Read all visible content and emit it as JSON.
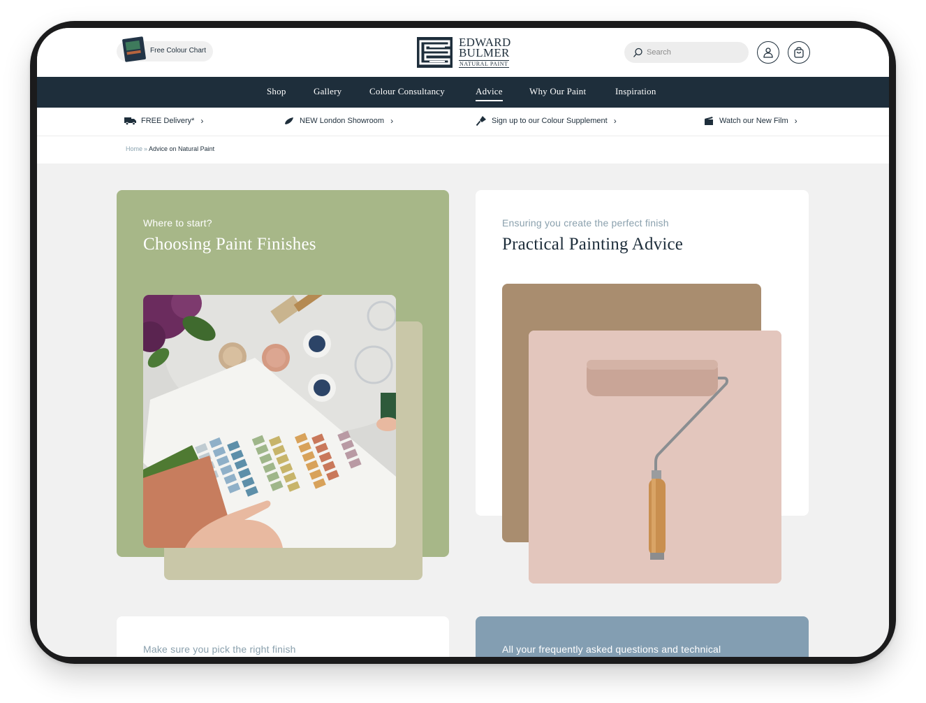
{
  "header": {
    "colour_chart_label": "Free Colour Chart",
    "logo_line1": "EDWARD",
    "logo_line2": "BULMER",
    "logo_line3": "NATURAL PAINT",
    "search_placeholder": "Search",
    "icons": {
      "search": "search-icon",
      "account": "user-icon",
      "basket": "basket-icon"
    }
  },
  "nav": {
    "items": [
      "Shop",
      "Gallery",
      "Colour Consultancy",
      "Advice",
      "Why Our Paint",
      "Inspiration"
    ],
    "active": "Advice"
  },
  "promo": {
    "items": [
      {
        "label": "FREE Delivery*",
        "icon": "truck-icon"
      },
      {
        "label": "NEW London Showroom",
        "icon": "brush-icon"
      },
      {
        "label": "Sign up to our Colour Supplement",
        "icon": "paint-brush-icon"
      },
      {
        "label": "Watch our New Film",
        "icon": "clapperboard-icon"
      }
    ],
    "chevron": "›"
  },
  "breadcrumb": {
    "home": "Home",
    "separator": "»",
    "current": "Advice on Natural Paint"
  },
  "cards": [
    {
      "eyebrow": "Where to start?",
      "title": "Choosing Paint Finishes",
      "color": "#a7b788"
    },
    {
      "eyebrow": "Ensuring you create the perfect finish",
      "title": "Practical Painting Advice",
      "color": "#ffffff"
    },
    {
      "eyebrow": "Make sure you pick the right finish",
      "color": "#ffffff"
    },
    {
      "eyebrow": "All your frequently asked questions and technical",
      "color": "#839eb2"
    }
  ],
  "colors": {
    "navy": "#1e2e3b",
    "sage": "#a7b788",
    "beige": "#c9c7a8",
    "tan": "#a98d6f",
    "blush": "#e3c6bd",
    "steel_blue": "#839eb2"
  }
}
